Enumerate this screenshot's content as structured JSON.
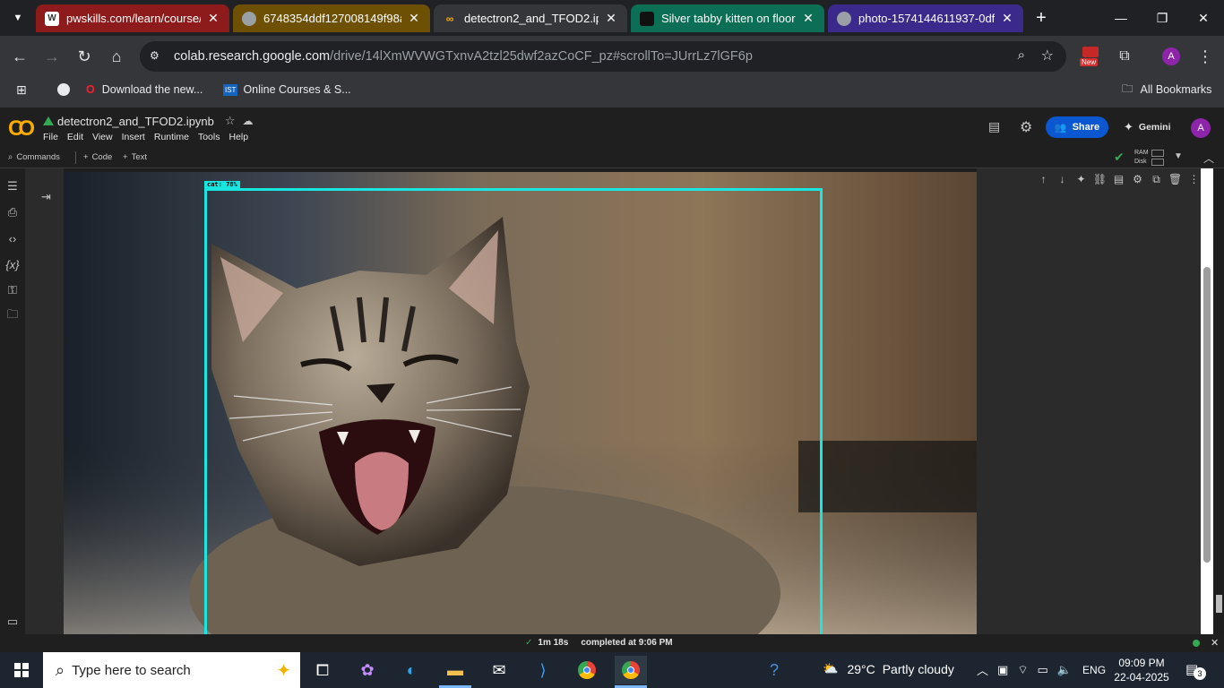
{
  "browser": {
    "tabs": [
      {
        "title": "pwskills.com/learn/course/g",
        "color": "#9e1e1e"
      },
      {
        "title": "6748354ddf127008149f98ab",
        "color": "#7a5a06"
      },
      {
        "title": "detectron2_and_TFOD2.ipyn",
        "color": "#35363a"
      },
      {
        "title": "Silver tabby kitten on floor p",
        "color": "#0b6e55"
      },
      {
        "title": "photo-1574144611937-0df0",
        "color": "#3b2a8c"
      }
    ],
    "close_glyph": "✕",
    "new_tab_glyph": "+",
    "url_host": "colab.research.google.com",
    "url_path": "/drive/14lXmWVWGTxnvA2tzl25dwf2azCoCF_pz#scrollTo=JUrrLz7lGF6p",
    "new_badge": "New",
    "profile_initial": "A"
  },
  "bookmarks": {
    "items": [
      "Download the new...",
      "Online Courses & S..."
    ],
    "ist_label": "IST",
    "all_bookmarks": "All Bookmarks"
  },
  "colab": {
    "notebook_title": "detectron2_and_TFOD2.ipynb",
    "menu": [
      "File",
      "Edit",
      "View",
      "Insert",
      "Runtime",
      "Tools",
      "Help"
    ],
    "share_label": "Share",
    "gemini_label": "Gemini",
    "user_initial": "A",
    "commands_label": "Commands",
    "code_label": "Code",
    "text_label": "Text",
    "ram_label": "RAM",
    "disk_label": "Disk",
    "detection_label": "cat: 78%",
    "status_duration": "1m 18s",
    "status_completed": "completed at 9:06 PM"
  },
  "taskbar": {
    "search_placeholder": "Type here to search",
    "weather_temp": "29°C",
    "weather_desc": "Partly cloudy",
    "language": "ENG",
    "time": "09:09 PM",
    "date": "22-04-2025",
    "notification_count": "3"
  },
  "colors": {
    "accent_share": "#0b57d0",
    "detection_box": "#19e6e0",
    "profile": "#8e24aa"
  }
}
